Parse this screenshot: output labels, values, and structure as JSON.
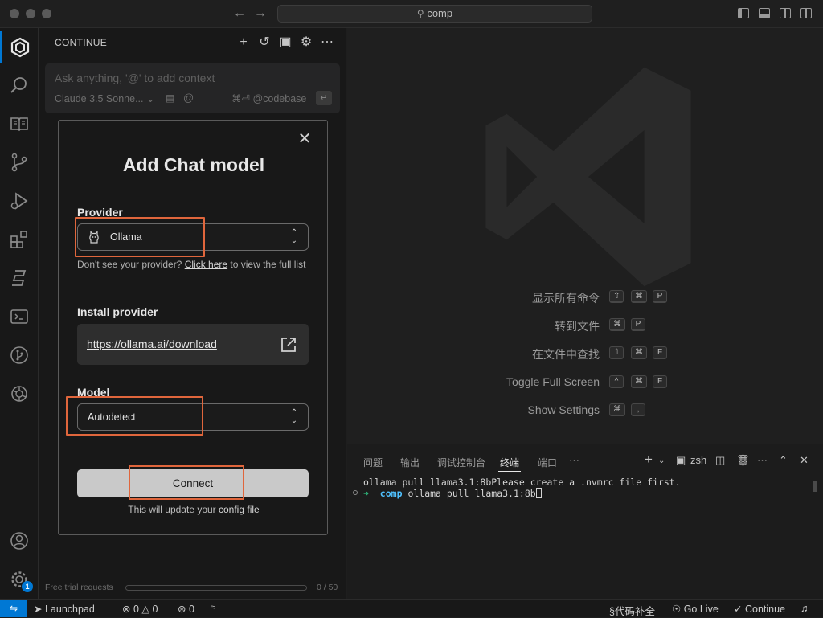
{
  "titlebar": {
    "search_text": "comp"
  },
  "sidebar": {
    "title": "CONTINUE",
    "input_placeholder": "Ask anything, '@' to add context",
    "model_selector": "Claude 3.5 Sonne...",
    "codebase_hint": "⌘⏎ @codebase",
    "trial_label": "Free trial requests",
    "trial_count": "0 / 50",
    "trial_progress": 0
  },
  "dialog": {
    "title": "Add Chat model",
    "provider_label": "Provider",
    "provider_value": "Ollama",
    "hint_prefix": "Don't see your provider? ",
    "hint_link": "Click here",
    "hint_suffix": " to view the full list",
    "install_label": "Install provider",
    "install_url": "https://ollama.ai/download",
    "model_label": "Model",
    "model_value": "Autodetect",
    "connect_label": "Connect",
    "footer_prefix": "This will update your ",
    "footer_link": "config file"
  },
  "shortcuts": [
    {
      "label": "显示所有命令",
      "keys": [
        "⇧",
        "⌘",
        "P"
      ]
    },
    {
      "label": "转到文件",
      "keys": [
        "⌘",
        "P"
      ]
    },
    {
      "label": "在文件中查找",
      "keys": [
        "⇧",
        "⌘",
        "F"
      ]
    },
    {
      "label": "Toggle Full Screen",
      "keys": [
        "^",
        "⌘",
        "F"
      ]
    },
    {
      "label": "Show Settings",
      "keys": [
        "⌘",
        ","
      ]
    }
  ],
  "panel": {
    "tabs": [
      "问题",
      "输出",
      "调试控制台",
      "终端",
      "端口"
    ],
    "active_tab": "终端",
    "shell_label": "zsh",
    "terminal_line1": "ollama pull llama3.1:8bPlease create a .nvmrc file first.",
    "terminal_prompt_arrow": "➜",
    "terminal_dir": "comp",
    "terminal_command": "ollama pull llama3.1:8b"
  },
  "statusbar": {
    "launchpad": "Launchpad",
    "errors": "0",
    "warnings": "0",
    "ports": "0",
    "code_completion": "代码补全",
    "go_live": "Go Live",
    "continue": "Continue"
  },
  "activity_badge": "1",
  "colors": {
    "accent": "#0078d4",
    "highlight": "#e0663c",
    "connect_button": "#c9c9c9",
    "terminal_prompt": "#2fb77c"
  }
}
